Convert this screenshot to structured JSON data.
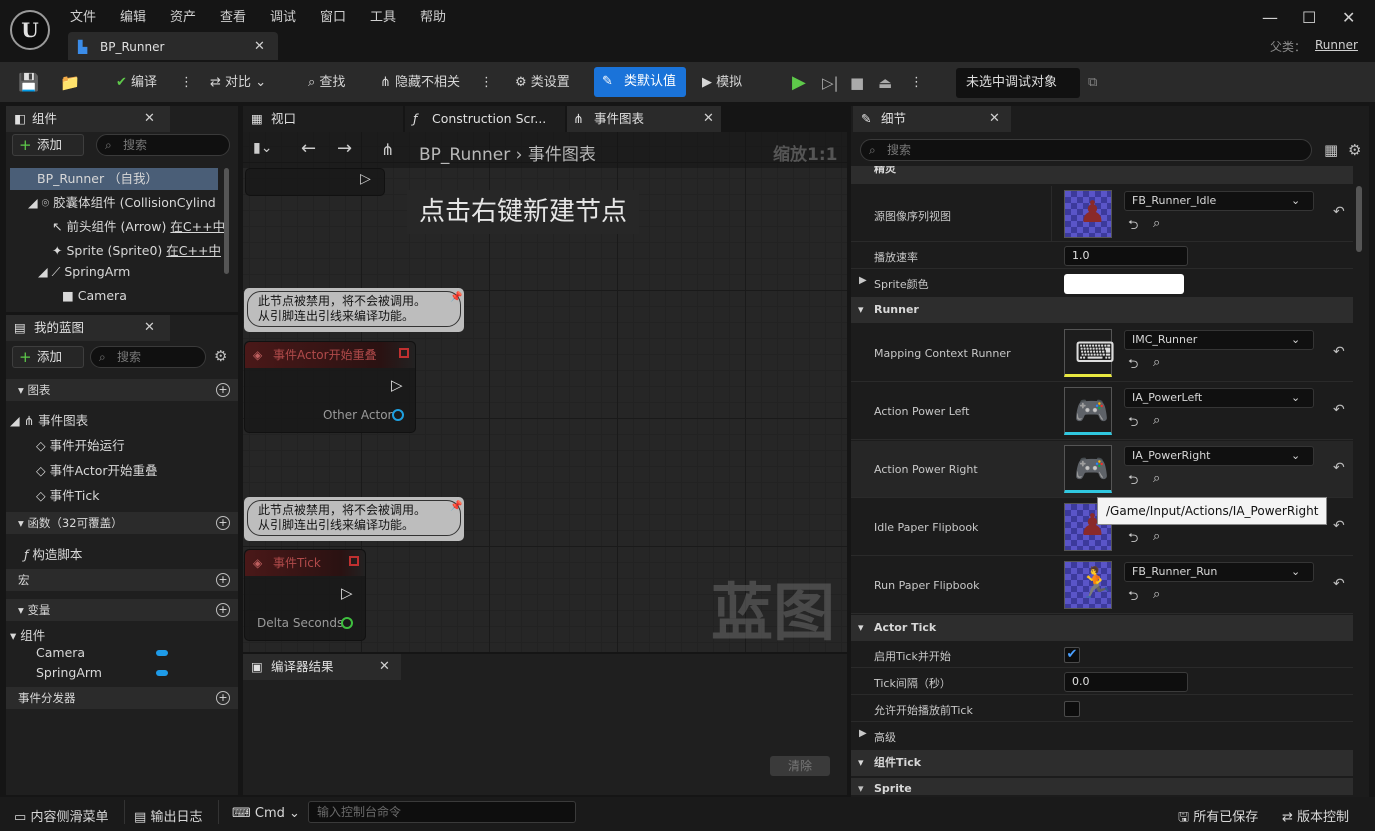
{
  "menu": [
    "文件",
    "编辑",
    "资产",
    "查看",
    "调试",
    "窗口",
    "工具",
    "帮助"
  ],
  "tab": {
    "title": "BP_Runner"
  },
  "parent": {
    "label": "父类：",
    "value": "Runner"
  },
  "toolbar": {
    "compile": "编译",
    "diff": "对比",
    "find": "查找",
    "hide": "隐藏不相关",
    "class_settings": "类设置",
    "class_defaults": "类默认值",
    "simulate": "模拟",
    "debug_target": "未选中调试对象"
  },
  "components": {
    "title": "组件",
    "add": "添加",
    "search_placeholder": "搜索",
    "items": [
      {
        "label": "BP_Runner （自我）"
      },
      {
        "label": "胶囊体组件 (CollisionCylind"
      },
      {
        "label": "前头组件 (Arrow)",
        "suffix": "在C++中"
      },
      {
        "label": "Sprite (Sprite0)",
        "suffix": "在C++中"
      },
      {
        "label": "SpringArm"
      },
      {
        "label": "Camera"
      }
    ]
  },
  "blueprint": {
    "title": "我的蓝图",
    "add": "添加",
    "search_placeholder": "搜索",
    "graphs_header": "图表",
    "event_graph": "事件图表",
    "events": [
      "事件开始运行",
      "事件Actor开始重叠",
      "事件Tick"
    ],
    "functions_header": "函数（32可覆盖）",
    "construct": "构造脚本",
    "macros_header": "宏",
    "variables_header": "变量",
    "components_group": "组件",
    "vars": [
      "Camera",
      "SpringArm"
    ],
    "dispatchers_header": "事件分发器"
  },
  "viewtabs": {
    "viewport": "视口",
    "construction": "Construction Scr...",
    "event_graph": "事件图表"
  },
  "graph": {
    "breadcrumb_root": "BP_Runner",
    "breadcrumb_leaf": "事件图表",
    "zoom": "缩放1:1",
    "hint": "点击右键新建节点",
    "watermark": "蓝图",
    "comment1": "此节点被禁用，将不会被调用。",
    "comment2": "从引脚连出引线来编译功能。",
    "node_overlap": "事件Actor开始重叠",
    "pin_other_actor": "Other Actor",
    "node_tick": "事件Tick",
    "pin_delta": "Delta Seconds"
  },
  "compiler": {
    "title": "编译器结果",
    "clear": "清除"
  },
  "details": {
    "title": "细节",
    "search_placeholder": "搜索",
    "cat_sprite": "精灵",
    "source_flipbook_label": "源图像序列视图",
    "source_flipbook": "FB_Runner_Idle",
    "play_rate_label": "播放速率",
    "play_rate": "1.0",
    "sprite_color_label": "Sprite颜色",
    "cat_runner": "Runner",
    "rows": [
      {
        "label": "Mapping Context Runner",
        "value": "IMC_Runner"
      },
      {
        "label": "Action Power Left",
        "value": "IA_PowerLeft"
      },
      {
        "label": "Action Power Right",
        "value": "IA_PowerRight"
      },
      {
        "label": "Idle Paper Flipbook",
        "value": ""
      },
      {
        "label": "Run Paper Flipbook",
        "value": "FB_Runner_Run"
      }
    ],
    "tooltip": "/Game/Input/Actions/IA_PowerRight",
    "cat_tick": "Actor Tick",
    "tick_start_label": "启用Tick并开始",
    "tick_interval_label": "Tick间隔（秒）",
    "tick_interval": "0.0",
    "tick_before_label": "允许开始播放前Tick",
    "advanced": "高级",
    "cat_component_tick": "组件Tick",
    "cat_sprite2": "Sprite"
  },
  "statusbar": {
    "content_drawer": "内容侧滑菜单",
    "output_log": "输出日志",
    "cmd": "Cmd",
    "cmd_placeholder": "输入控制台命令",
    "all_saved": "所有已保存",
    "source_control": "版本控制"
  },
  "colors": {
    "accent": "#1a73d9",
    "var_pill": "#1e9be8"
  }
}
